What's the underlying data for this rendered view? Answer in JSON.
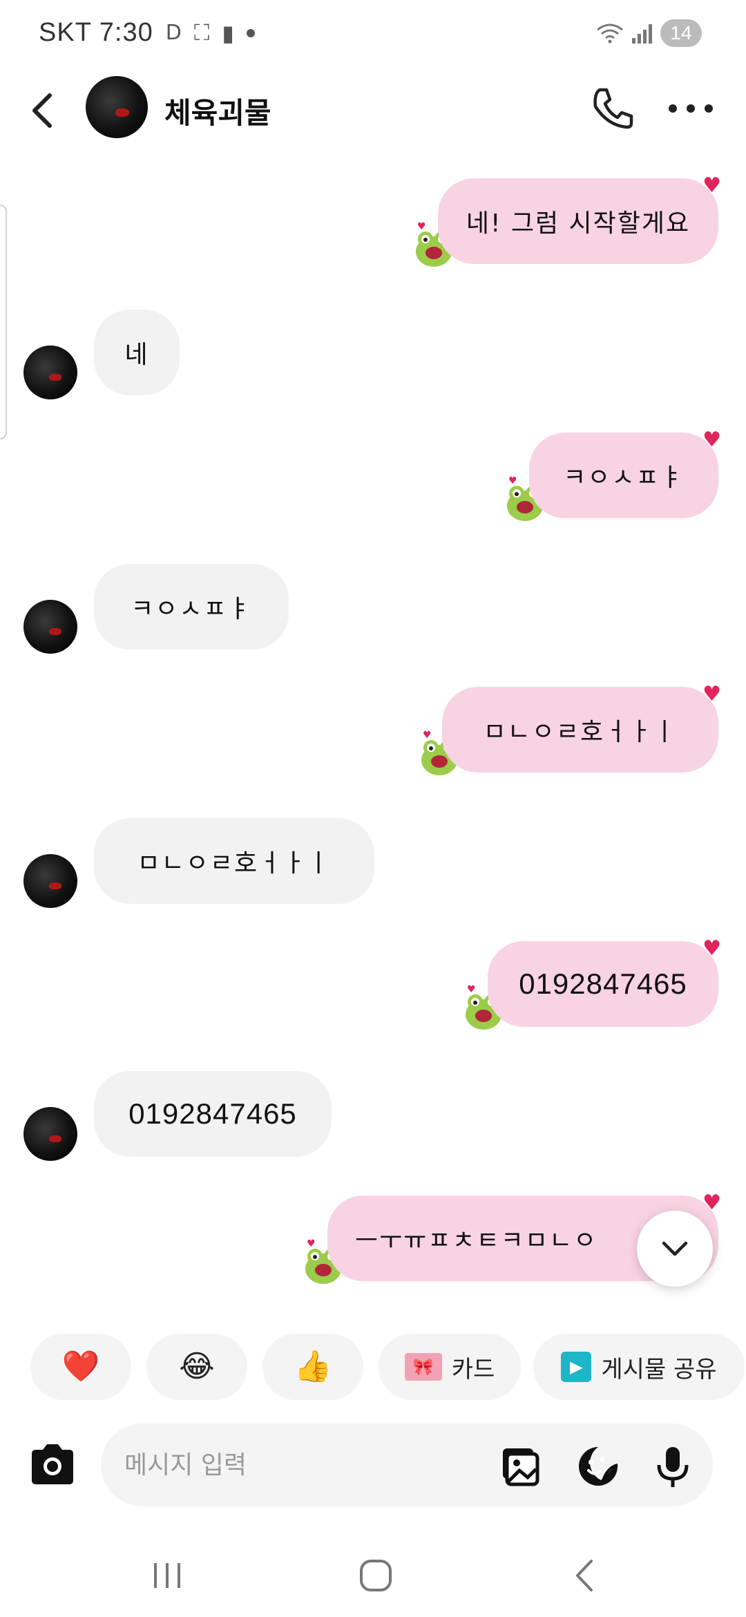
{
  "status_bar": {
    "carrier": "SKT",
    "time": "7:30",
    "indicator_d": "D",
    "battery_level": "14"
  },
  "header": {
    "contact_name": "체육괴물"
  },
  "messages": [
    {
      "side": "sent",
      "text": "네! 그럼 시작할게요"
    },
    {
      "side": "recv",
      "text": "네"
    },
    {
      "side": "sent",
      "text": "ㅋㅇㅅㅍㅑ"
    },
    {
      "side": "recv",
      "text": "ㅋㅇㅅㅍㅑ"
    },
    {
      "side": "sent",
      "text": "ㅁㄴㅇㄹ호ㅓㅏㅣ"
    },
    {
      "side": "recv",
      "text": "ㅁㄴㅇㄹ호ㅓㅏㅣ"
    },
    {
      "side": "sent",
      "text": "0192847465"
    },
    {
      "side": "recv",
      "text": "0192847465"
    },
    {
      "side": "sent",
      "text": "ㅡㅜㅠㅍㅊㅌㅋㅁㄴㅇ"
    }
  ],
  "quick_replies": {
    "heart": "❤️",
    "laugh": "😂",
    "thumbs": "👍",
    "card_label": "카드",
    "share_label": "게시물 공유"
  },
  "composer": {
    "placeholder": "메시지 입력"
  },
  "icons": {
    "back": "chevron-left-icon",
    "call": "phone-icon",
    "more": "more-dots-icon",
    "camera": "camera-icon",
    "gallery": "gallery-icon",
    "sticker": "sticker-icon",
    "mic": "microphone-icon"
  },
  "colors": {
    "sent_bubble": "#f8d3e3",
    "recv_bubble": "#f2f2f2",
    "heart": "#e0245e"
  }
}
